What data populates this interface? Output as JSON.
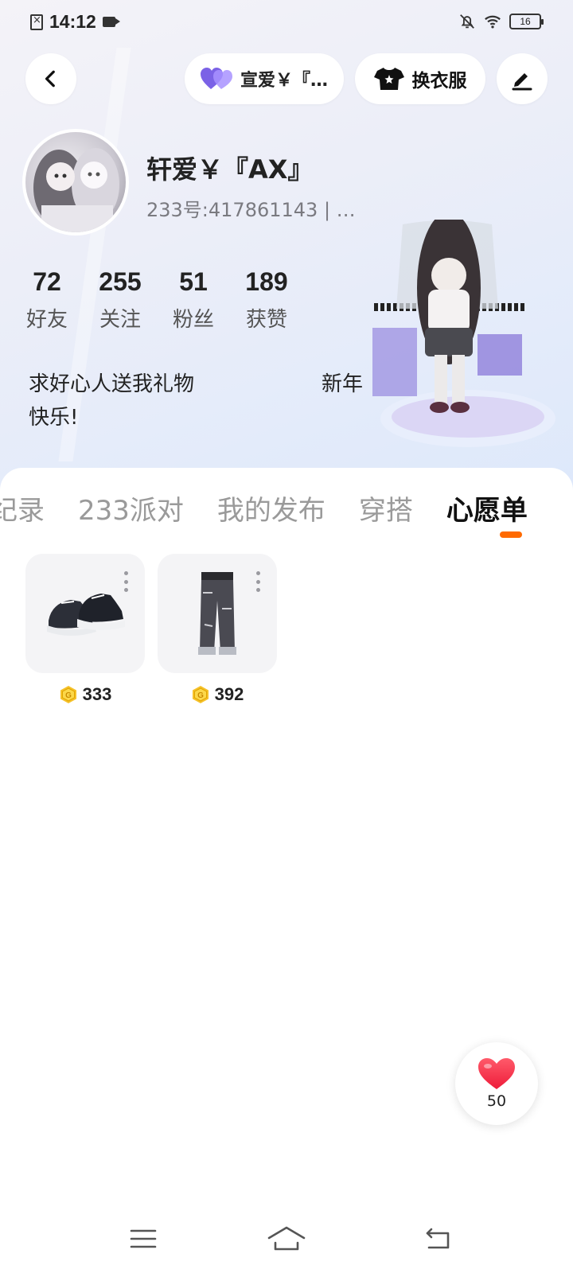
{
  "status_bar": {
    "time": "14:12",
    "battery": "16",
    "icons": [
      "sim-error-icon",
      "video-record-icon",
      "bell-off-icon",
      "wifi-icon",
      "battery-icon"
    ]
  },
  "top_bar": {
    "couple_label": "宣爱￥『…",
    "outfit_label": "换衣服"
  },
  "profile": {
    "nickname": "轩爱￥『AX』",
    "user_id": "233号:417861143 | …"
  },
  "stats": [
    {
      "value": "72",
      "label": "好友"
    },
    {
      "value": "255",
      "label": "关注"
    },
    {
      "value": "51",
      "label": "粉丝"
    },
    {
      "value": "189",
      "label": "获赞"
    }
  ],
  "bio": {
    "line1_left": "求好心人送我礼物",
    "line1_right": "新年",
    "line2": "快乐!"
  },
  "tabs": [
    {
      "label": "纪录"
    },
    {
      "label": "233派对"
    },
    {
      "label": "我的发布"
    },
    {
      "label": "穿搭"
    },
    {
      "label": "心愿单"
    }
  ],
  "active_tab": "心愿单",
  "accent_color": "#ff6a00",
  "wishlist": [
    {
      "item": "shoes",
      "price": "333"
    },
    {
      "item": "pants",
      "price": "392"
    }
  ],
  "like_button": {
    "count": "50"
  },
  "nav_bar": {
    "icons": [
      "menu-icon",
      "home-icon",
      "back-nav-icon"
    ]
  }
}
